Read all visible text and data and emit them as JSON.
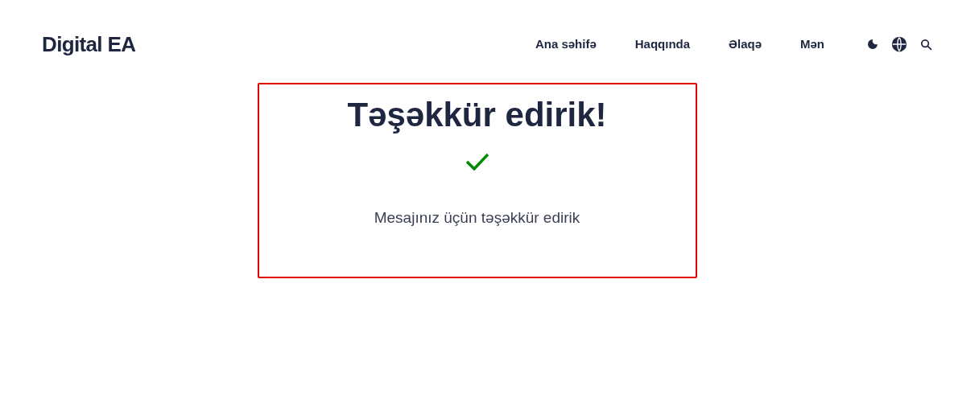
{
  "brand": "Digital EA",
  "nav": [
    {
      "label": "Ana səhifə"
    },
    {
      "label": "Haqqında"
    },
    {
      "label": "Əlaqə"
    },
    {
      "label": "Mən"
    }
  ],
  "card": {
    "title": "Təşəkkür edirik!",
    "message": "Mesajınız üçün təşəkkür edirik"
  }
}
